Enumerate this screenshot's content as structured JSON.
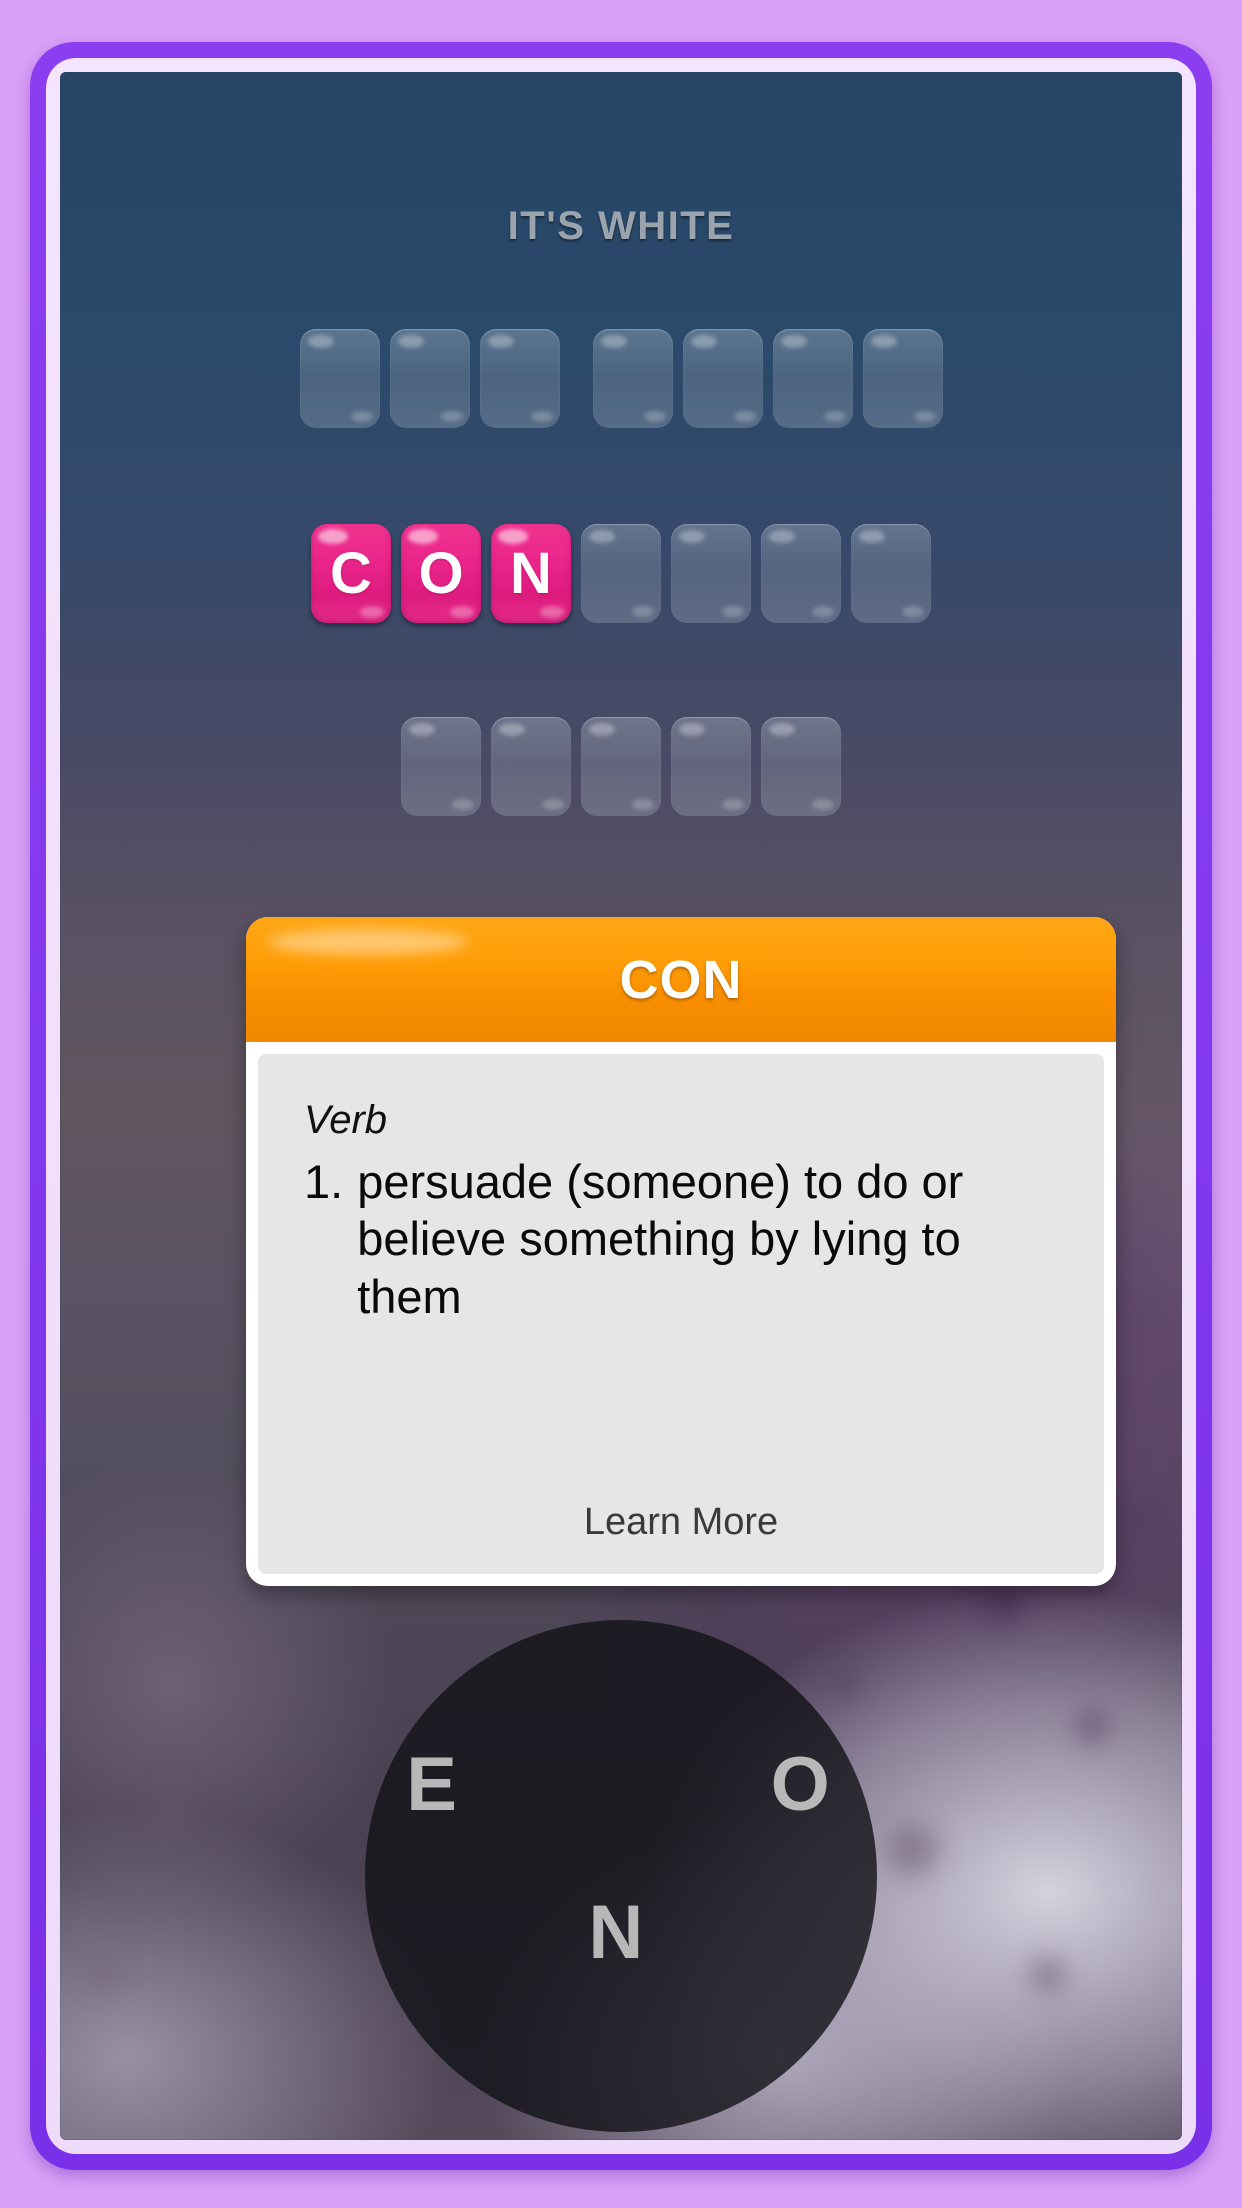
{
  "screen": {
    "clue": "IT'S WHITE"
  },
  "answer_grid": {
    "rows": [
      {
        "row_index": 0,
        "tiles": [
          {
            "letter": "",
            "state": "empty",
            "gap_after": false
          },
          {
            "letter": "",
            "state": "empty",
            "gap_after": false
          },
          {
            "letter": "",
            "state": "empty",
            "gap_after": true
          },
          {
            "letter": "",
            "state": "empty",
            "gap_after": false
          },
          {
            "letter": "",
            "state": "empty",
            "gap_after": false
          },
          {
            "letter": "",
            "state": "empty",
            "gap_after": false
          },
          {
            "letter": "",
            "state": "empty",
            "gap_after": false
          }
        ]
      },
      {
        "row_index": 1,
        "tiles": [
          {
            "letter": "C",
            "state": "filled",
            "gap_after": false
          },
          {
            "letter": "O",
            "state": "filled",
            "gap_after": false
          },
          {
            "letter": "N",
            "state": "filled",
            "gap_after": false
          },
          {
            "letter": "",
            "state": "empty",
            "gap_after": false
          },
          {
            "letter": "",
            "state": "empty",
            "gap_after": false
          },
          {
            "letter": "",
            "state": "empty",
            "gap_after": false
          },
          {
            "letter": "",
            "state": "empty",
            "gap_after": false
          }
        ]
      },
      {
        "row_index": 2,
        "tiles": [
          {
            "letter": "",
            "state": "empty",
            "gap_after": false
          },
          {
            "letter": "",
            "state": "empty",
            "gap_after": false
          },
          {
            "letter": "",
            "state": "empty",
            "gap_after": false
          },
          {
            "letter": "",
            "state": "empty",
            "gap_after": false
          },
          {
            "letter": "",
            "state": "empty",
            "gap_after": false
          }
        ]
      }
    ]
  },
  "definition_popup": {
    "title": "CON",
    "part_of_speech": "Verb",
    "entries": [
      {
        "number": "1.",
        "text": "persuade (someone) to do or believe something by lying to them"
      }
    ],
    "learn_more_label": "Learn More"
  },
  "letter_wheel": {
    "letters": [
      "E",
      "O",
      "N"
    ]
  },
  "colors": {
    "page_background": "#d9a0f7",
    "device_bezel": "#8b3ef0",
    "device_inner_ring": "#f5e4fd",
    "tile_filled": "#e9248a",
    "tile_empty": "#b2becb",
    "popup_header": "#ff9d07",
    "popup_body": "#e6e6e6",
    "clue_text": "#9ba4ac",
    "wheel_background": "#121216",
    "wheel_letter": "#b8b8b8"
  }
}
